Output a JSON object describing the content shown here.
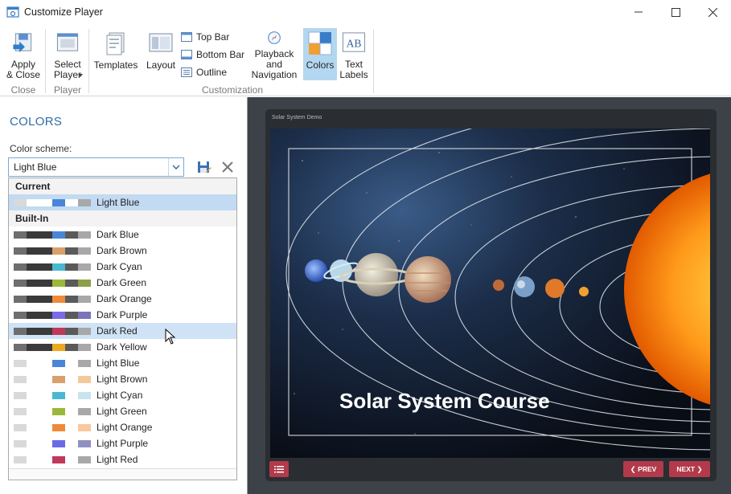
{
  "window": {
    "title": "Customize Player"
  },
  "ribbon": {
    "apply_close": "Apply\n& Close",
    "select_player": "Select\nPlayer",
    "templates": "Templates",
    "layout": "Layout",
    "top_bar": "Top Bar",
    "bottom_bar": "Bottom Bar",
    "outline": "Outline",
    "playback": "Playback and\nNavigation",
    "colors": "Colors",
    "text_labels": "Text\nLabels",
    "groups": {
      "close": "Close",
      "player": "Player",
      "customization": "Customization"
    }
  },
  "panel": {
    "title": "COLORS",
    "scheme_label": "Color scheme:",
    "scheme_value": "Light Blue"
  },
  "dropdown": {
    "current_header": "Current",
    "builtin_header": "Built-In",
    "current": {
      "label": "Light Blue",
      "colors": [
        "#d9d9d9",
        "#ffffff",
        "#ffffff",
        "#4a86d8",
        "#ffffff",
        "#a8a8a8"
      ]
    },
    "items": [
      {
        "label": "Dark Blue",
        "colors": [
          "#6e6e6e",
          "#3a3a3a",
          "#3a3a3a",
          "#4a86d8",
          "#5a5a5a",
          "#a8a8a8"
        ]
      },
      {
        "label": "Dark Brown",
        "colors": [
          "#6e6e6e",
          "#3a3a3a",
          "#3a3a3a",
          "#d9a06a",
          "#5a5a5a",
          "#a8a8a8"
        ]
      },
      {
        "label": "Dark Cyan",
        "colors": [
          "#6e6e6e",
          "#3a3a3a",
          "#3a3a3a",
          "#4ab8d0",
          "#5a5a5a",
          "#a8a8a8"
        ]
      },
      {
        "label": "Dark Green",
        "colors": [
          "#6e6e6e",
          "#3a3a3a",
          "#3a3a3a",
          "#9ab83a",
          "#5a5a5a",
          "#8aa04a"
        ]
      },
      {
        "label": "Dark Orange",
        "colors": [
          "#6e6e6e",
          "#3a3a3a",
          "#3a3a3a",
          "#f08a3a",
          "#5a5a5a",
          "#a8a8a8"
        ]
      },
      {
        "label": "Dark Purple",
        "colors": [
          "#6e6e6e",
          "#3a3a3a",
          "#3a3a3a",
          "#7a6ae8",
          "#5a5a5a",
          "#7a74b8"
        ]
      },
      {
        "label": "Dark Red",
        "colors": [
          "#6e6e6e",
          "#3a3a3a",
          "#3a3a3a",
          "#c0395a",
          "#5a5a5a",
          "#a8a8a8"
        ]
      },
      {
        "label": "Dark Yellow",
        "colors": [
          "#6e6e6e",
          "#3a3a3a",
          "#3a3a3a",
          "#f0a820",
          "#5a5a5a",
          "#a8a8a8"
        ]
      },
      {
        "label": "Light Blue",
        "colors": [
          "#d9d9d9",
          "#ffffff",
          "#ffffff",
          "#4a86d8",
          "#ffffff",
          "#a8a8a8"
        ]
      },
      {
        "label": "Light Brown",
        "colors": [
          "#d9d9d9",
          "#ffffff",
          "#ffffff",
          "#d9a06a",
          "#ffffff",
          "#f5c89a"
        ]
      },
      {
        "label": "Light Cyan",
        "colors": [
          "#d9d9d9",
          "#ffffff",
          "#ffffff",
          "#4ab8d0",
          "#ffffff",
          "#c8e4ee"
        ]
      },
      {
        "label": "Light Green",
        "colors": [
          "#d9d9d9",
          "#ffffff",
          "#ffffff",
          "#9ab83a",
          "#ffffff",
          "#a8a8a8"
        ]
      },
      {
        "label": "Light Orange",
        "colors": [
          "#d9d9d9",
          "#ffffff",
          "#ffffff",
          "#f08a3a",
          "#ffffff",
          "#f8c8a0"
        ]
      },
      {
        "label": "Light Purple",
        "colors": [
          "#d9d9d9",
          "#ffffff",
          "#ffffff",
          "#6a6ae8",
          "#ffffff",
          "#9090c0"
        ]
      },
      {
        "label": "Light Red",
        "colors": [
          "#d9d9d9",
          "#ffffff",
          "#ffffff",
          "#c0395a",
          "#ffffff",
          "#a8a8a8"
        ]
      }
    ],
    "hovered_index": 6
  },
  "preview": {
    "player_title": "Solar System Demo",
    "slide_title": "Solar System Course",
    "prev_label": "❮ PREV",
    "next_label": "NEXT ❯",
    "accent": "#b23a4a"
  },
  "colors": {
    "accent_blue": "#2f6ea5",
    "active_ribbon": "#b3d7f0"
  }
}
